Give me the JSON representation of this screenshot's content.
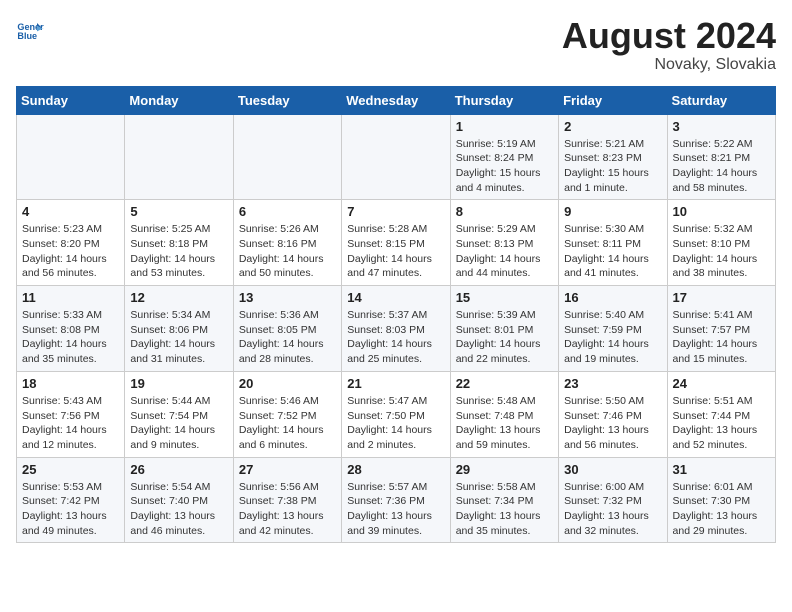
{
  "header": {
    "logo_line1": "General",
    "logo_line2": "Blue",
    "month_year": "August 2024",
    "location": "Novaky, Slovakia"
  },
  "weekdays": [
    "Sunday",
    "Monday",
    "Tuesday",
    "Wednesday",
    "Thursday",
    "Friday",
    "Saturday"
  ],
  "weeks": [
    [
      {
        "day": "",
        "info": ""
      },
      {
        "day": "",
        "info": ""
      },
      {
        "day": "",
        "info": ""
      },
      {
        "day": "",
        "info": ""
      },
      {
        "day": "1",
        "info": "Sunrise: 5:19 AM\nSunset: 8:24 PM\nDaylight: 15 hours\nand 4 minutes."
      },
      {
        "day": "2",
        "info": "Sunrise: 5:21 AM\nSunset: 8:23 PM\nDaylight: 15 hours\nand 1 minute."
      },
      {
        "day": "3",
        "info": "Sunrise: 5:22 AM\nSunset: 8:21 PM\nDaylight: 14 hours\nand 58 minutes."
      }
    ],
    [
      {
        "day": "4",
        "info": "Sunrise: 5:23 AM\nSunset: 8:20 PM\nDaylight: 14 hours\nand 56 minutes."
      },
      {
        "day": "5",
        "info": "Sunrise: 5:25 AM\nSunset: 8:18 PM\nDaylight: 14 hours\nand 53 minutes."
      },
      {
        "day": "6",
        "info": "Sunrise: 5:26 AM\nSunset: 8:16 PM\nDaylight: 14 hours\nand 50 minutes."
      },
      {
        "day": "7",
        "info": "Sunrise: 5:28 AM\nSunset: 8:15 PM\nDaylight: 14 hours\nand 47 minutes."
      },
      {
        "day": "8",
        "info": "Sunrise: 5:29 AM\nSunset: 8:13 PM\nDaylight: 14 hours\nand 44 minutes."
      },
      {
        "day": "9",
        "info": "Sunrise: 5:30 AM\nSunset: 8:11 PM\nDaylight: 14 hours\nand 41 minutes."
      },
      {
        "day": "10",
        "info": "Sunrise: 5:32 AM\nSunset: 8:10 PM\nDaylight: 14 hours\nand 38 minutes."
      }
    ],
    [
      {
        "day": "11",
        "info": "Sunrise: 5:33 AM\nSunset: 8:08 PM\nDaylight: 14 hours\nand 35 minutes."
      },
      {
        "day": "12",
        "info": "Sunrise: 5:34 AM\nSunset: 8:06 PM\nDaylight: 14 hours\nand 31 minutes."
      },
      {
        "day": "13",
        "info": "Sunrise: 5:36 AM\nSunset: 8:05 PM\nDaylight: 14 hours\nand 28 minutes."
      },
      {
        "day": "14",
        "info": "Sunrise: 5:37 AM\nSunset: 8:03 PM\nDaylight: 14 hours\nand 25 minutes."
      },
      {
        "day": "15",
        "info": "Sunrise: 5:39 AM\nSunset: 8:01 PM\nDaylight: 14 hours\nand 22 minutes."
      },
      {
        "day": "16",
        "info": "Sunrise: 5:40 AM\nSunset: 7:59 PM\nDaylight: 14 hours\nand 19 minutes."
      },
      {
        "day": "17",
        "info": "Sunrise: 5:41 AM\nSunset: 7:57 PM\nDaylight: 14 hours\nand 15 minutes."
      }
    ],
    [
      {
        "day": "18",
        "info": "Sunrise: 5:43 AM\nSunset: 7:56 PM\nDaylight: 14 hours\nand 12 minutes."
      },
      {
        "day": "19",
        "info": "Sunrise: 5:44 AM\nSunset: 7:54 PM\nDaylight: 14 hours\nand 9 minutes."
      },
      {
        "day": "20",
        "info": "Sunrise: 5:46 AM\nSunset: 7:52 PM\nDaylight: 14 hours\nand 6 minutes."
      },
      {
        "day": "21",
        "info": "Sunrise: 5:47 AM\nSunset: 7:50 PM\nDaylight: 14 hours\nand 2 minutes."
      },
      {
        "day": "22",
        "info": "Sunrise: 5:48 AM\nSunset: 7:48 PM\nDaylight: 13 hours\nand 59 minutes."
      },
      {
        "day": "23",
        "info": "Sunrise: 5:50 AM\nSunset: 7:46 PM\nDaylight: 13 hours\nand 56 minutes."
      },
      {
        "day": "24",
        "info": "Sunrise: 5:51 AM\nSunset: 7:44 PM\nDaylight: 13 hours\nand 52 minutes."
      }
    ],
    [
      {
        "day": "25",
        "info": "Sunrise: 5:53 AM\nSunset: 7:42 PM\nDaylight: 13 hours\nand 49 minutes."
      },
      {
        "day": "26",
        "info": "Sunrise: 5:54 AM\nSunset: 7:40 PM\nDaylight: 13 hours\nand 46 minutes."
      },
      {
        "day": "27",
        "info": "Sunrise: 5:56 AM\nSunset: 7:38 PM\nDaylight: 13 hours\nand 42 minutes."
      },
      {
        "day": "28",
        "info": "Sunrise: 5:57 AM\nSunset: 7:36 PM\nDaylight: 13 hours\nand 39 minutes."
      },
      {
        "day": "29",
        "info": "Sunrise: 5:58 AM\nSunset: 7:34 PM\nDaylight: 13 hours\nand 35 minutes."
      },
      {
        "day": "30",
        "info": "Sunrise: 6:00 AM\nSunset: 7:32 PM\nDaylight: 13 hours\nand 32 minutes."
      },
      {
        "day": "31",
        "info": "Sunrise: 6:01 AM\nSunset: 7:30 PM\nDaylight: 13 hours\nand 29 minutes."
      }
    ]
  ]
}
